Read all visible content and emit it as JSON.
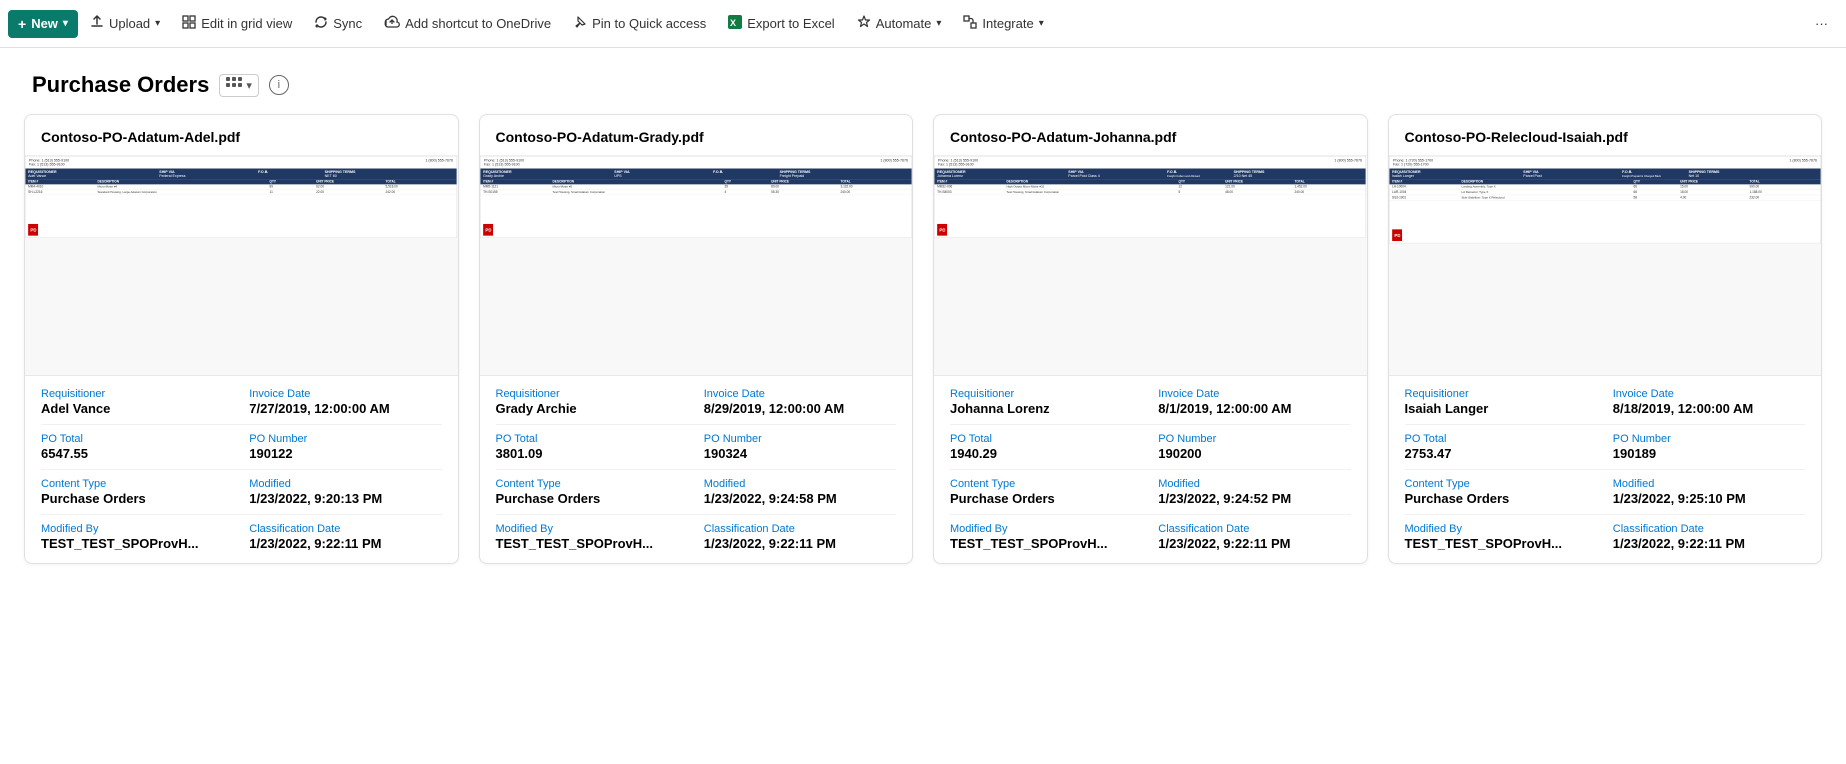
{
  "toolbar": {
    "new_label": "New",
    "upload_label": "Upload",
    "edit_grid_label": "Edit in grid view",
    "sync_label": "Sync",
    "add_shortcut_label": "Add shortcut to OneDrive",
    "pin_label": "Pin to Quick access",
    "export_label": "Export to Excel",
    "automate_label": "Automate",
    "integrate_label": "Integrate",
    "more_label": "..."
  },
  "page": {
    "title": "Purchase Orders",
    "view_icon": "grid-view-icon",
    "info_icon": "info-icon"
  },
  "cards": [
    {
      "id": "card-1",
      "filename": "Contoso-PO-Adatum-Adel.pdf",
      "requisitioner_label": "Requisitioner",
      "requisitioner_value": "Adel Vance",
      "invoice_date_label": "Invoice Date",
      "invoice_date_value": "7/27/2019, 12:00:00 AM",
      "po_total_label": "PO Total",
      "po_total_value": "6547.55",
      "po_number_label": "PO Number",
      "po_number_value": "190122",
      "content_type_label": "Content Type",
      "content_type_value": "Purchase Orders",
      "modified_label": "Modified",
      "modified_value": "1/23/2022, 9:20:13 PM",
      "modified_by_label": "Modified By",
      "modified_by_value": "TEST_TEST_SPOProvH...",
      "classification_date_label": "Classification Date",
      "classification_date_value": "1/23/2022, 9:22:11 PM",
      "doc": {
        "phone": "Phone: 1 (513) 555-9100",
        "fax": "Fax: 1 (513) 555-9100",
        "phone2": "1 (800) 555-7676",
        "requisitioner": "Adel Vance",
        "ship_via": "Federal Express",
        "fob": "",
        "shipping_terms": "NET 60",
        "dest": "PIA",
        "rows": [
          {
            "item": "MM4-4010",
            "desc": "Micro-Motor #4",
            "qty": "89",
            "unit": "62.00",
            "total": "5,518.00"
          },
          {
            "item": "SH-L2216",
            "desc": "Standard Housing, Large\nAdatum Corporation",
            "qty": "11",
            "unit": "22.00",
            "total": "242.00"
          }
        ]
      }
    },
    {
      "id": "card-2",
      "filename": "Contoso-PO-Adatum-Grady.pdf",
      "requisitioner_label": "Requisitioner",
      "requisitioner_value": "Grady Archie",
      "invoice_date_label": "Invoice Date",
      "invoice_date_value": "8/29/2019, 12:00:00 AM",
      "po_total_label": "PO Total",
      "po_total_value": "3801.09",
      "po_number_label": "PO Number",
      "po_number_value": "190324",
      "content_type_label": "Content Type",
      "content_type_value": "Purchase Orders",
      "modified_label": "Modified",
      "modified_value": "1/23/2022, 9:24:58 PM",
      "modified_by_label": "Modified By",
      "modified_by_value": "TEST_TEST_SPOProvH...",
      "classification_date_label": "Classification Date",
      "classification_date_value": "1/23/2022, 9:22:11 PM",
      "doc": {
        "phone": "Phone: 1 (513) 555-9100",
        "fax": "Fax: 1 (513) 555-9100",
        "phone2": "1 (800) 555-7676",
        "requisitioner": "Grady Archie",
        "ship_via": "UPS",
        "fob": "",
        "shipping_terms": "Freight Prepaid",
        "dest": "NET 20",
        "rows": [
          {
            "item": "MM5-1121",
            "desc": "Micro-Motor #5",
            "qty": "35",
            "unit": "89.00",
            "total": "3,115.00"
          },
          {
            "item": "TH-S0155",
            "desc": "Test Housing, Small\nAdatum Corporation",
            "qty": "4",
            "unit": "55.30",
            "total": "240.00"
          }
        ]
      }
    },
    {
      "id": "card-3",
      "filename": "Contoso-PO-Adatum-Johanna.pdf",
      "requisitioner_label": "Requisitioner",
      "requisitioner_value": "Johanna Lorenz",
      "invoice_date_label": "Invoice Date",
      "invoice_date_value": "8/1/2019, 12:00:00 AM",
      "po_total_label": "PO Total",
      "po_total_value": "1940.29",
      "po_number_label": "PO Number",
      "po_number_value": "190200",
      "content_type_label": "Content Type",
      "content_type_value": "Purchase Orders",
      "modified_label": "Modified",
      "modified_value": "1/23/2022, 9:24:52 PM",
      "modified_by_label": "Modified By",
      "modified_by_value": "TEST_TEST_SPOProvH...",
      "classification_date_label": "Classification Date",
      "classification_date_value": "1/23/2022, 9:22:11 PM",
      "doc": {
        "phone": "Phone: 1 (513) 555-9100",
        "fax": "Fax: 1 (513) 555-9100",
        "phone2": "1 (800) 555-7676",
        "requisitioner": "Johanna Lorenz",
        "ship_via": "Parcel Post Class 4",
        "fob": "Freight Collect and Allowed",
        "shipping_terms": "2/10 Net 45",
        "dest": "",
        "rows": [
          {
            "item": "MM32-006",
            "desc": "High Output Micro-Motor #32",
            "qty": "12",
            "unit": "121.00",
            "total": "1,452.00"
          },
          {
            "item": "TH-S8003",
            "desc": "Test Housing, Small\nAdatum Corporation",
            "qty": "5",
            "unit": "48.00",
            "total": "240.00"
          }
        ]
      }
    },
    {
      "id": "card-4",
      "filename": "Contoso-PO-Relecloud-Isaiah.pdf",
      "requisitioner_label": "Requisitioner",
      "requisitioner_value": "Isaiah Langer",
      "invoice_date_label": "Invoice Date",
      "invoice_date_value": "8/18/2019, 12:00:00 AM",
      "po_total_label": "PO Total",
      "po_total_value": "2753.47",
      "po_number_label": "PO Number",
      "po_number_value": "190189",
      "content_type_label": "Content Type",
      "content_type_value": "Purchase Orders",
      "modified_label": "Modified",
      "modified_value": "1/23/2022, 9:25:10 PM",
      "modified_by_label": "Modified By",
      "modified_by_value": "TEST_TEST_SPOProvH...",
      "classification_date_label": "Classification Date",
      "classification_date_value": "1/23/2022, 9:22:11 PM",
      "doc": {
        "phone": "Phone: 1 (720) 555-1700",
        "fax": "Fax: 1 (720) 555-1700",
        "phone2": "1 (800) 555-7676",
        "requisitioner": "Isaiah Langer",
        "ship_via": "Parcel Post",
        "fob": "Freight Prepaid & Charged Back",
        "shipping_terms": "Net 10",
        "dest": "",
        "rows": [
          {
            "item": "LA-10004",
            "desc": "Landing Assembly, Type X",
            "qty": "66",
            "unit": "15.00",
            "total": "990.00"
          },
          {
            "item": "LAR-1004",
            "desc": "LA Retractor, Type X",
            "qty": "66",
            "unit": "18.00",
            "total": "1,188.00"
          },
          {
            "item": "SS2-1001",
            "desc": "Side Stabilizer, Type X\nRelecloud",
            "qty": "58",
            "unit": "4.00",
            "total": "232.00"
          }
        ]
      }
    }
  ]
}
